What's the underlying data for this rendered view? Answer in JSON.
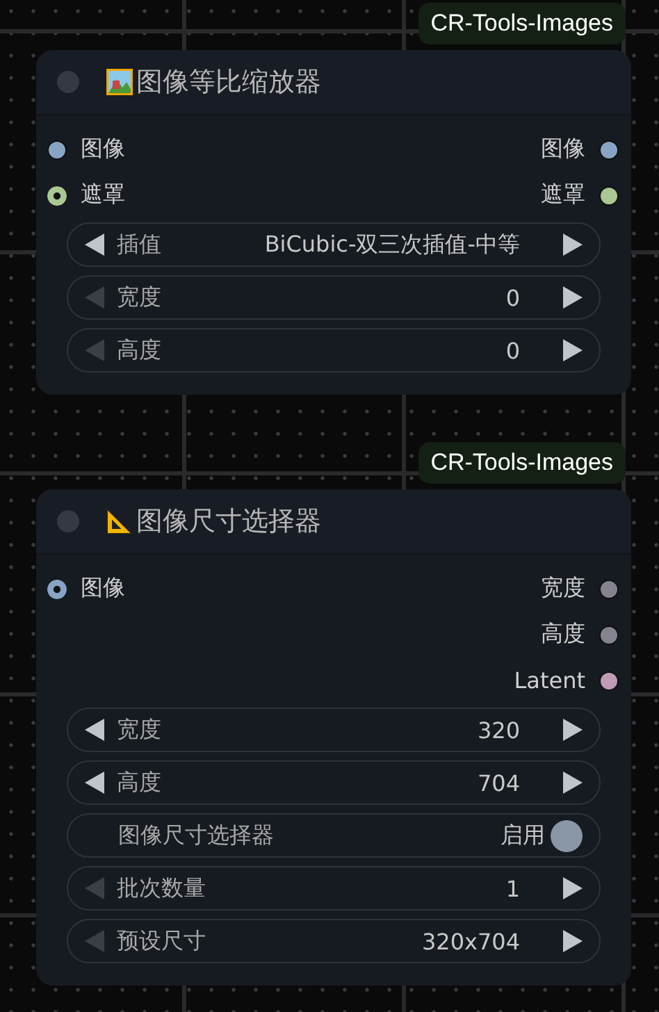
{
  "nodes": [
    {
      "badge": "CR-Tools-Images",
      "title": "图像等比缩放器",
      "inputs": [
        {
          "label": "图像",
          "connected": true,
          "color": "#88a4c4"
        },
        {
          "label": "遮罩",
          "connected": false,
          "color": "#a9c894"
        }
      ],
      "outputs": [
        {
          "label": "图像",
          "color": "#88a4c4"
        },
        {
          "label": "遮罩",
          "color": "#a9c894"
        }
      ],
      "widgets": [
        {
          "kind": "stepper",
          "label": "插值",
          "value": "BiCubic-双三次插值-中等",
          "decrement_disabled": false
        },
        {
          "kind": "stepper",
          "label": "宽度",
          "value": "0",
          "decrement_disabled": true
        },
        {
          "kind": "stepper",
          "label": "高度",
          "value": "0",
          "decrement_disabled": true
        }
      ]
    },
    {
      "badge": "CR-Tools-Images",
      "title": "图像尺寸选择器",
      "inputs": [
        {
          "label": "图像",
          "connected": false,
          "color": "#88a4c4"
        }
      ],
      "outputs": [
        {
          "label": "宽度",
          "color": "#85838f"
        },
        {
          "label": "高度",
          "color": "#85838f"
        },
        {
          "label": "Latent",
          "color": "#c19ab5"
        }
      ],
      "widgets": [
        {
          "kind": "stepper",
          "label": "宽度",
          "value": "320",
          "decrement_disabled": false
        },
        {
          "kind": "stepper",
          "label": "高度",
          "value": "704",
          "decrement_disabled": false
        },
        {
          "kind": "toggle",
          "label": "图像尺寸选择器",
          "value": "启用",
          "on": true
        },
        {
          "kind": "stepper",
          "label": "批次数量",
          "value": "1",
          "decrement_disabled": true
        },
        {
          "kind": "stepper",
          "label": "预设尺寸",
          "value": "320x704",
          "decrement_disabled": true
        }
      ]
    }
  ]
}
